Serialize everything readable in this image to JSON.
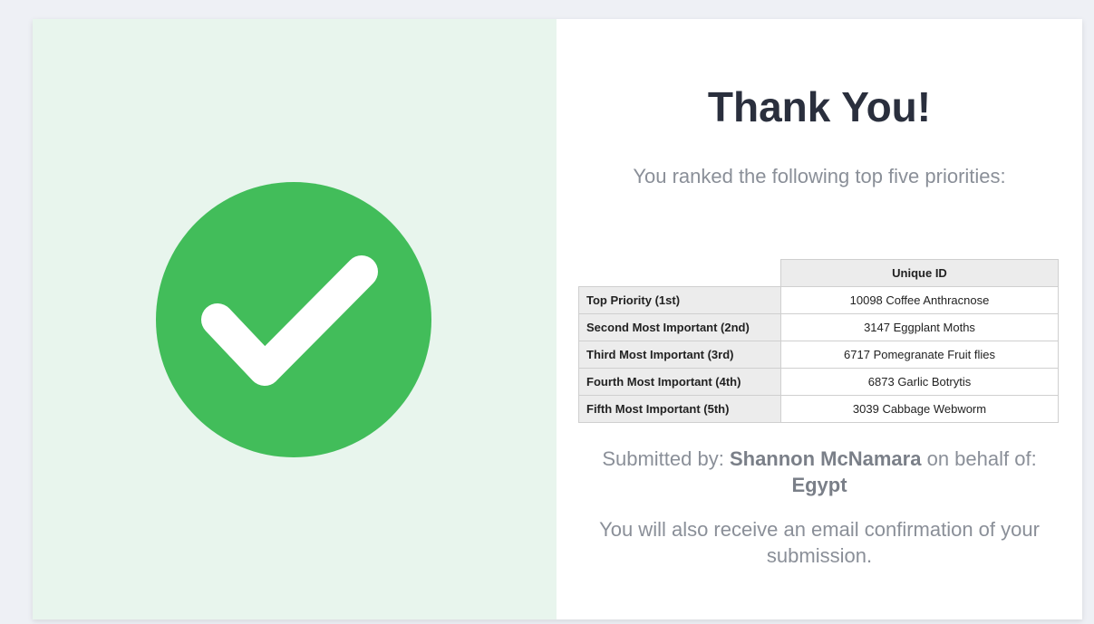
{
  "colors": {
    "check_green": "#42bd5a",
    "left_panel_bg": "#e8f5ed",
    "title_text": "#2a2f3d",
    "body_text": "#8a8f98"
  },
  "icons": {
    "success": "checkmark-circle-icon"
  },
  "confirmation": {
    "title": "Thank You!",
    "subtitle": "You ranked the following top five priorities:"
  },
  "table": {
    "header_blank": "",
    "header_id": "Unique ID",
    "rows": [
      {
        "label": "Top Priority (1st)",
        "value": "10098 Coffee Anthracnose"
      },
      {
        "label": "Second Most Important (2nd)",
        "value": "3147 Eggplant Moths"
      },
      {
        "label": "Third Most Important (3rd)",
        "value": "6717 Pomegranate Fruit flies"
      },
      {
        "label": "Fourth Most Important (4th)",
        "value": "6873 Garlic Botrytis"
      },
      {
        "label": "Fifth Most Important (5th)",
        "value": "3039 Cabbage Webworm"
      }
    ]
  },
  "submission": {
    "prefix": "Submitted by:",
    "submitter": "Shannon McNamara",
    "middle": "on behalf of:",
    "country": "Egypt",
    "email_note": "You will also receive an email confirmation of your submission."
  }
}
